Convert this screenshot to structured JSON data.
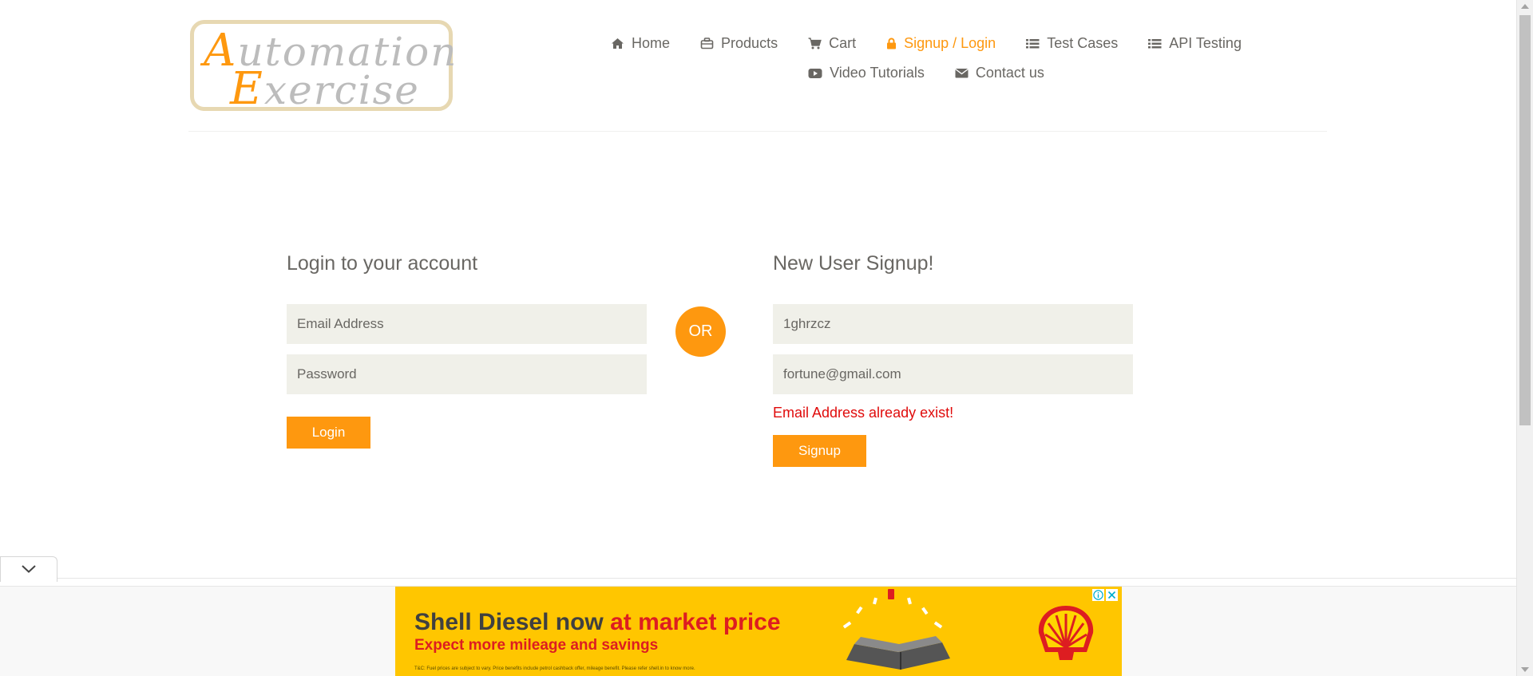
{
  "colors": {
    "accent": "#fe980f",
    "text": "#696763",
    "error": "#e00b0b",
    "input_bg": "#f0f0e9",
    "ad_bg": "#ffc600",
    "ad_red": "#dd1d21"
  },
  "logo": {
    "line1_cap": "A",
    "line1_rest": "utomation",
    "line2_cap": "E",
    "line2_rest": "xercise"
  },
  "nav": {
    "row1": [
      {
        "label": "Home",
        "icon": "home-icon"
      },
      {
        "label": "Products",
        "icon": "briefcase-icon"
      },
      {
        "label": "Cart",
        "icon": "cart-icon"
      },
      {
        "label": "Signup / Login",
        "icon": "lock-icon",
        "active": true
      },
      {
        "label": "Test Cases",
        "icon": "list-icon"
      },
      {
        "label": "API Testing",
        "icon": "list-icon"
      }
    ],
    "row2": [
      {
        "label": "Video Tutorials",
        "icon": "youtube-icon"
      },
      {
        "label": "Contact us",
        "icon": "envelope-icon"
      }
    ]
  },
  "login": {
    "title": "Login to your account",
    "email_placeholder": "Email Address",
    "password_placeholder": "Password",
    "button": "Login"
  },
  "or_label": "OR",
  "signup": {
    "title": "New User Signup!",
    "name_value": "1ghrzcz",
    "email_value": "fortune@gmail.com",
    "error": "Email Address already exist!",
    "button": "Signup"
  },
  "ad": {
    "headline_start": "Shell Diesel now ",
    "headline_highlight": "at market price",
    "subline": "Expect more mileage and savings",
    "fine_print": "T&C: Fuel prices are subject to vary. Price benefits include petrol cashback offer, mileage benefit. Please refer shell.in to know more.",
    "info_icon": "info-icon",
    "close_icon": "close-icon"
  }
}
